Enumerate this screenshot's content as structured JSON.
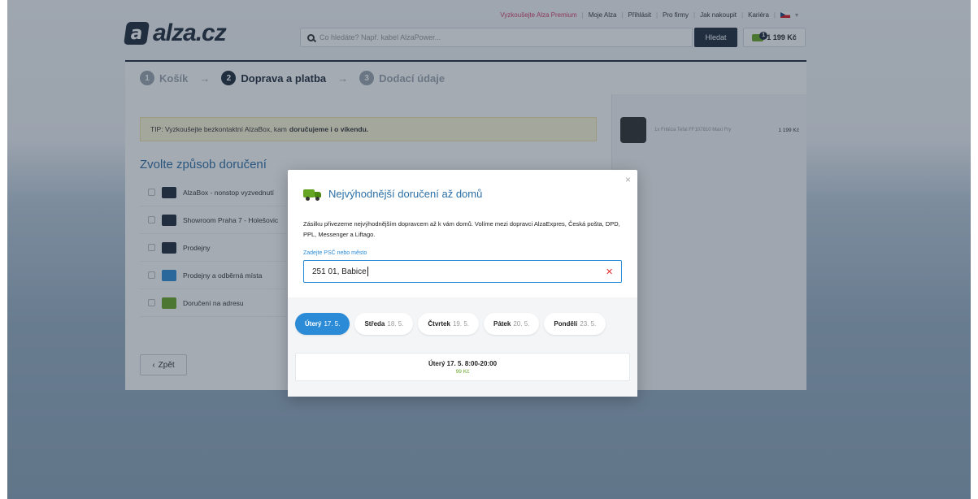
{
  "header": {
    "top_links": [
      "Vyzkoušejte Alza Premium",
      "Moje Alza",
      "Přihlásit",
      "Pro firmy",
      "Jak nakoupit",
      "Kariéra"
    ],
    "logo_mark": "a",
    "logo_text": "alza.cz",
    "search_placeholder": "Co hledáte? Např. kabel AlzaPower...",
    "search_button": "Hledat",
    "cart_count": "1",
    "cart_total": "1 199 Kč"
  },
  "steps": [
    {
      "num": "1",
      "label": "Košík"
    },
    {
      "num": "2",
      "label": "Doprava a platba"
    },
    {
      "num": "3",
      "label": "Dodací údaje"
    }
  ],
  "main": {
    "tip_text": "TIP: Vyzkoušejte bezkontaktní AlzaBox, kam",
    "tip_bold": "doručujeme i o víkendu.",
    "section_title": "Zvolte způsob doručení",
    "options": [
      {
        "label": "AlzaBox - nonstop vyzvednutí"
      },
      {
        "label": "Showroom Praha 7 - Holešovic"
      },
      {
        "label": "Prodejny"
      },
      {
        "label": "Prodejny a odběrná místa"
      },
      {
        "label": "Doručení na adresu"
      }
    ],
    "back_label": "Zpět"
  },
  "sidebar": {
    "item_name": "1x Fritéza Tefal FF107810 Maxi Fry",
    "item_price": "1 199 Kč"
  },
  "modal": {
    "title": "Nejvýhodnější doručení až domů",
    "description": "Zásilku přivezeme nejvýhodnějším dopravcem až k vám domů. Volíme mezi dopravci AlzaExpres, Česká pošta, DPD, PPL, Messenger a Liftago.",
    "zip_label": "Zadejte PSČ nebo město",
    "zip_value": "251 01, Babice",
    "close": "×",
    "clear": "✕",
    "days": [
      {
        "name": "Úterý",
        "date": "17. 5."
      },
      {
        "name": "Středa",
        "date": "18. 5."
      },
      {
        "name": "Čtvrtek",
        "date": "19. 5."
      },
      {
        "name": "Pátek",
        "date": "20. 5."
      },
      {
        "name": "Pondělí",
        "date": "23. 5."
      }
    ],
    "slot_time": "Úterý 17. 5. 8:00-20:00",
    "slot_price": "99 Kč"
  },
  "colors": {
    "brand_dark": "#1a2838",
    "link_blue": "#2b6fa6",
    "accent_blue": "#2b8bd6",
    "green": "#66a523",
    "premium": "#d43c6a"
  }
}
